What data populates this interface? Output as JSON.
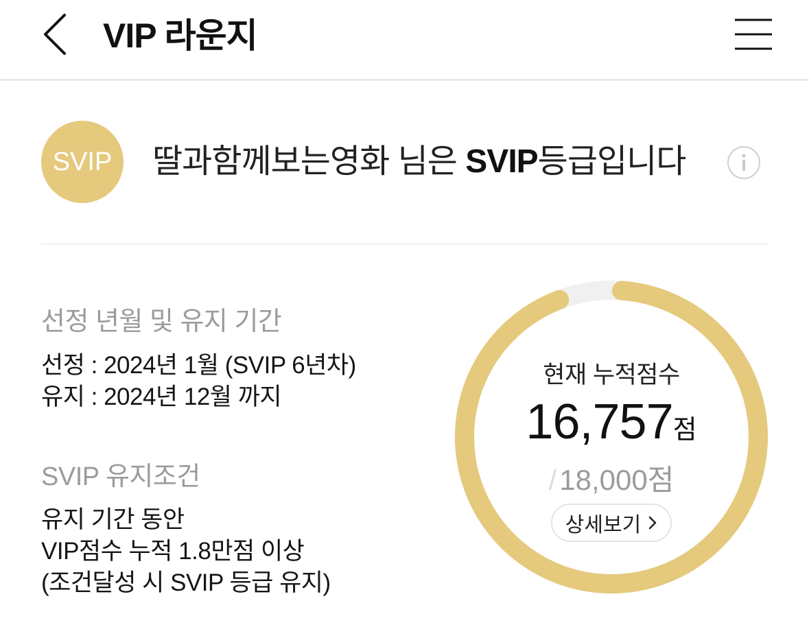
{
  "header": {
    "title": "VIP 라운지",
    "back_icon": "chevron-left-icon",
    "menu_icon": "hamburger-menu-icon"
  },
  "grade": {
    "badge": "SVIP",
    "user_name": "딸과함께보는영화",
    "honorific": " 님은 ",
    "grade_name": "SVIP",
    "grade_suffix": "등급입니다",
    "info_icon": "info-icon"
  },
  "selection": {
    "title": "선정 년월 및 유지 기간",
    "lines": [
      "선정 : 2024년 1월 (SVIP 6년차)",
      "유지 : 2024년 12월 까지"
    ]
  },
  "condition": {
    "title": "SVIP 유지조건",
    "lines": [
      "유지 기간 동안",
      "VIP점수 누적 1.8만점 이상",
      "(조건달성 시 SVIP 등급 유지)"
    ]
  },
  "score": {
    "label": "현재 누적점수",
    "current": "16,757",
    "unit": "점",
    "max": "18,000점",
    "slash": "/",
    "progress": 0.931,
    "detail_button": "상세보기",
    "detail_icon": "chevron-right-icon"
  },
  "colors": {
    "accent": "#e5c97d",
    "ring_track": "#f0f0f0",
    "muted_text": "#9b9b9b",
    "divider": "#c9c9c9"
  }
}
